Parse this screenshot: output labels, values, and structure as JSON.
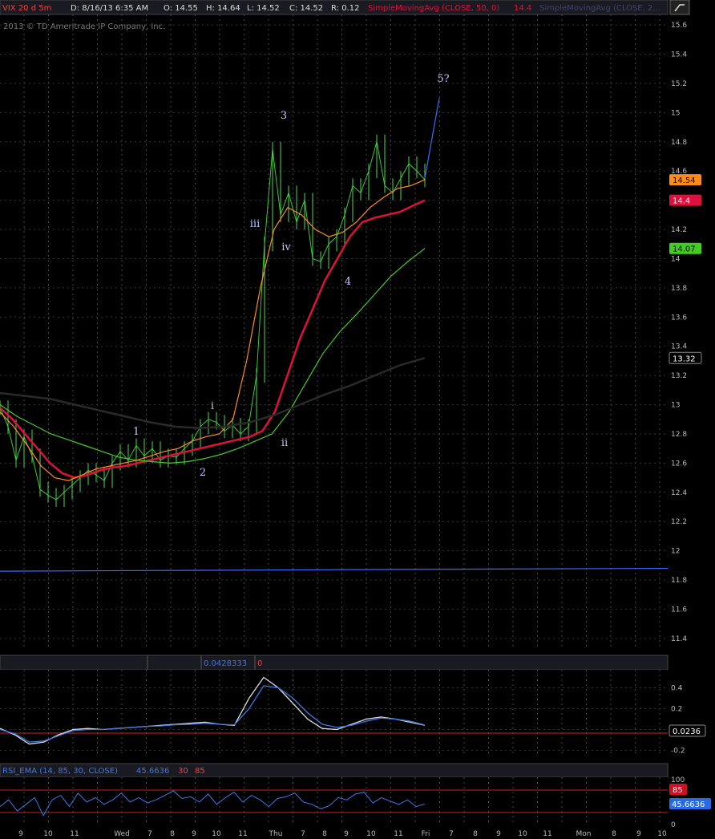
{
  "header": {
    "symbol": "VIX 20 d 5m",
    "date": "D: 8/16/13 6:35 AM",
    "open": "O: 14.55",
    "high": "H: 14.64",
    "low": "L: 14.52",
    "close": "C: 14.52",
    "range": "R: 0.12",
    "study1": "SimpleMovingAvg (CLOSE, 50, 0)",
    "study1_value": "14.4",
    "study2": "SimpleMovingAvg (CLOSE, 2..."
  },
  "copyright": "2013 © TD Ameritrade IP Company, Inc.",
  "osc_panel": {
    "value": "0.0428333",
    "zero": "0"
  },
  "rsi_panel": {
    "title": "RSI_EMA (14, 85, 30, CLOSE)",
    "value": "45.6636",
    "upper": "30",
    "lower": "85"
  },
  "price_badges": [
    {
      "label": "14.54",
      "color": "#ff8c1a"
    },
    {
      "label": "14.4",
      "color": "#e0103c"
    },
    {
      "label": "14.07",
      "color": "#44cc22"
    },
    {
      "label": "13.32",
      "color": "#2a2a2a"
    }
  ],
  "osc_badge": "0.0236",
  "rsi_badges": {
    "upper": "85",
    "value": "45.6636"
  },
  "wave_labels": [
    "1",
    "2",
    "i",
    "ii",
    "iii",
    "iv",
    "3",
    "4",
    "5?"
  ],
  "x_ticks": [
    "9",
    "10",
    "11",
    "Wed",
    "7",
    "8",
    "9",
    "10",
    "11",
    "Thu",
    "7",
    "8",
    "9",
    "10",
    "11",
    "Fri",
    "7",
    "8",
    "9",
    "10",
    "11",
    "Mon",
    "8",
    "9",
    "10"
  ],
  "chart_data": [
    {
      "type": "line",
      "title": "VIX 20 d 5m",
      "ylim": [
        11.35,
        15.65
      ],
      "y_ticks": [
        "15.6",
        "15.4",
        "15.2",
        "15",
        "14.8",
        "14.6",
        "14.4",
        "14.2",
        "14",
        "13.8",
        "13.6",
        "13.4",
        "13.2",
        "13",
        "12.8",
        "12.6",
        "12.4",
        "12.2",
        "12",
        "11.8",
        "11.6",
        "11.4"
      ],
      "series": [
        {
          "name": "price",
          "color": "#33cc33",
          "values": [
            12.98,
            12.85,
            12.62,
            12.78,
            12.65,
            12.42,
            12.38,
            12.35,
            12.4,
            12.45,
            12.5,
            12.55,
            12.52,
            12.48,
            12.6,
            12.68,
            12.62,
            12.72,
            12.65,
            12.7,
            12.62,
            12.65,
            12.64,
            12.7,
            12.75,
            12.85,
            12.9,
            12.88,
            12.82,
            12.86,
            12.8,
            12.85,
            13.2,
            14.1,
            14.75,
            14.3,
            14.45,
            14.25,
            14.4,
            14.0,
            13.98,
            14.1,
            14.15,
            14.3,
            14.5,
            14.45,
            14.6,
            14.8,
            14.5,
            14.45,
            14.55,
            14.65,
            14.6,
            14.54
          ]
        },
        {
          "name": "",
          "color": "#e0103c",
          "values": [
            12.98,
            12.9,
            12.8,
            12.7,
            12.6,
            12.53,
            12.5,
            12.52,
            12.55,
            12.57,
            12.58,
            12.6,
            12.62,
            12.64,
            12.66,
            12.68,
            12.7,
            12.72,
            12.74,
            12.76,
            12.78,
            12.82,
            12.95,
            13.2,
            13.45,
            13.65,
            13.85,
            14.0,
            14.15,
            14.25,
            14.28,
            14.3,
            14.32,
            14.36,
            14.4
          ]
        },
        {
          "name": "",
          "color": "#ff8c1a",
          "values": [
            12.95,
            12.85,
            12.72,
            12.58,
            12.5,
            12.48,
            12.52,
            12.56,
            12.58,
            12.6,
            12.62,
            12.65,
            12.68,
            12.7,
            12.75,
            12.78,
            12.8,
            12.9,
            13.3,
            13.8,
            14.2,
            14.35,
            14.3,
            14.2,
            14.15,
            14.18,
            14.25,
            14.35,
            14.42,
            14.48,
            14.5,
            14.54
          ]
        },
        {
          "name": "",
          "color": "#44cc22",
          "values": [
            13.0,
            12.92,
            12.86,
            12.8,
            12.76,
            12.72,
            12.68,
            12.64,
            12.62,
            12.61,
            12.6,
            12.61,
            12.63,
            12.66,
            12.7,
            12.75,
            12.8,
            12.95,
            13.15,
            13.35,
            13.5,
            13.62,
            13.75,
            13.88,
            13.98,
            14.07
          ]
        },
        {
          "name": "",
          "color": "#2a2a2a",
          "values": [
            13.08,
            13.06,
            13.04,
            13.0,
            12.96,
            12.92,
            12.88,
            12.85,
            12.84,
            12.85,
            12.88,
            12.93,
            13.0,
            13.07,
            13.13,
            13.2,
            13.27,
            13.32
          ]
        },
        {
          "name": "",
          "color": "#3b6bff",
          "values": [
            14.55,
            15.1
          ]
        },
        {
          "name": "",
          "color": "#3b6bff",
          "values": [
            11.86,
            11.88
          ]
        }
      ]
    },
    {
      "type": "line",
      "ylim": [
        -0.25,
        0.55
      ],
      "y_ticks": [
        "0.4",
        "0.2",
        "0",
        "-0.2"
      ],
      "series": [
        {
          "name": "",
          "color": "#000000",
          "values": [
            0.01,
            -0.05,
            -0.14,
            -0.12,
            -0.05,
            0.0,
            0.01,
            0.0,
            0.01,
            0.02,
            0.03,
            0.04,
            0.05,
            0.06,
            0.07,
            0.05,
            0.04,
            0.3,
            0.5,
            0.4,
            0.25,
            0.1,
            0.01,
            0.0,
            0.05,
            0.1,
            0.12,
            0.1,
            0.07,
            0.04
          ]
        },
        {
          "name": "",
          "color": "#3b78e7",
          "values": [
            0.0,
            -0.04,
            -0.12,
            -0.11,
            -0.06,
            -0.01,
            0.0,
            0.0,
            0.01,
            0.02,
            0.03,
            0.035,
            0.045,
            0.05,
            0.06,
            0.05,
            0.045,
            0.2,
            0.42,
            0.4,
            0.3,
            0.16,
            0.05,
            0.02,
            0.04,
            0.08,
            0.11,
            0.1,
            0.08,
            0.043
          ]
        }
      ]
    },
    {
      "type": "line",
      "ylim": [
        0,
        100
      ],
      "y_ticks": [
        "100",
        "50",
        "0"
      ],
      "series": [
        {
          "name": "",
          "color": "#3b78e7",
          "values": [
            40,
            55,
            30,
            45,
            60,
            20,
            55,
            65,
            40,
            70,
            50,
            60,
            45,
            55,
            70,
            50,
            60,
            48,
            55,
            65,
            75,
            58,
            62,
            50,
            68,
            45,
            60,
            72,
            50,
            65,
            55,
            40,
            58,
            62,
            70,
            50,
            45,
            35,
            42,
            60,
            55,
            68,
            72,
            48,
            60,
            52,
            45,
            55,
            40,
            46
          ]
        }
      ]
    }
  ]
}
